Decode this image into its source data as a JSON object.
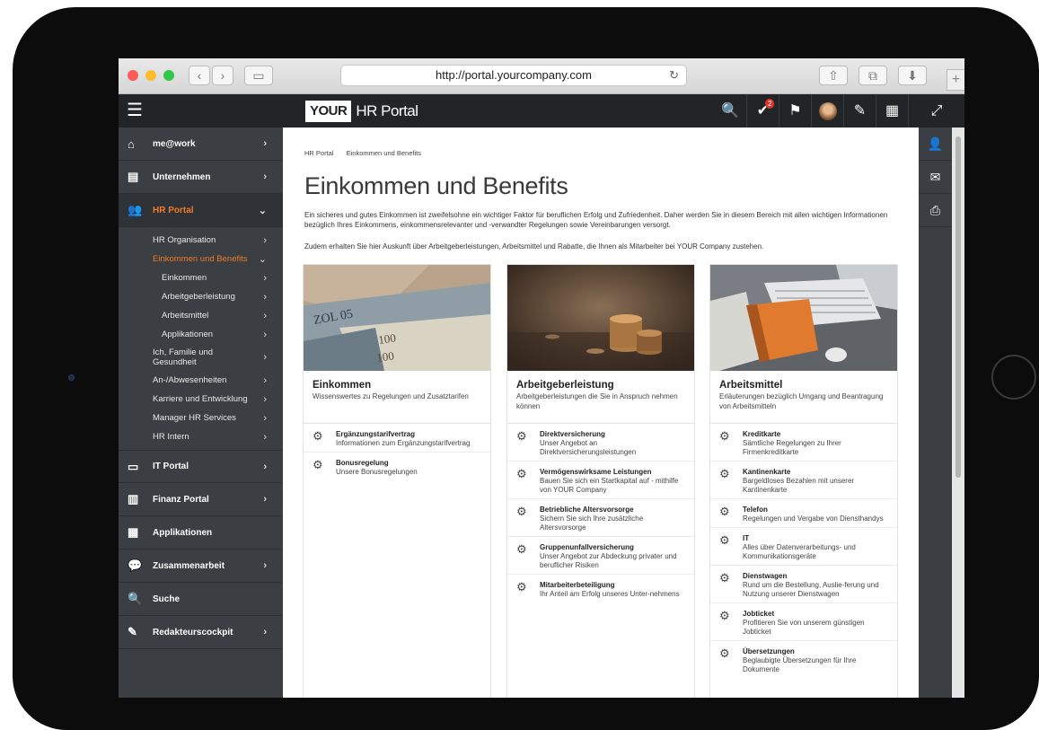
{
  "browser": {
    "url": "http://portal.yourcompany.com",
    "back_glyph": "‹",
    "forward_glyph": "›",
    "sidebar_glyph": "▭",
    "reload_glyph": "↻",
    "share_glyph": "⇧",
    "tabs_glyph": "⧉",
    "download_glyph": "⬇",
    "new_tab_glyph": "+"
  },
  "app": {
    "logo_your": "YOUR",
    "logo_rest": "HR Portal",
    "menu_glyph": "☰",
    "notification_count": "2",
    "icons": {
      "search": "🔍",
      "tasks": "✔",
      "flag": "⚑",
      "edit": "✎",
      "apps": "▦",
      "expand": "⤢"
    }
  },
  "sidebar": {
    "chevron_right": "›",
    "chevron_down": "⌄",
    "items": [
      {
        "label": "me@work",
        "icon": "⌂"
      },
      {
        "label": "Unternehmen",
        "icon": "▤"
      },
      {
        "label": "HR Portal",
        "icon": "👥"
      },
      {
        "label": "IT Portal",
        "icon": "▭"
      },
      {
        "label": "Finanz Portal",
        "icon": "▥"
      },
      {
        "label": "Applikationen",
        "icon": "▦"
      },
      {
        "label": "Zusammenarbeit",
        "icon": "💬"
      },
      {
        "label": "Suche",
        "icon": "🔍"
      },
      {
        "label": "Redakteurscockpit",
        "icon": "✎"
      }
    ],
    "hr_sub": [
      "HR Organisation",
      "Einkommen und Benefits",
      "Einkommen",
      "Arbeitgeberleistung",
      "Arbeitsmittel",
      "Applikationen",
      "Ich, Familie und Gesundheit",
      "An-/Abwesenheiten",
      "Karriere und Entwicklung",
      "Manager HR Services",
      "HR Intern"
    ]
  },
  "rightbar": {
    "user_glyph": "👤",
    "mail_glyph": "✉",
    "print_glyph": "⎙"
  },
  "content": {
    "breadcrumb": [
      "HR Portal",
      "Einkommen und Benefits"
    ],
    "title": "Einkommen und Benefits",
    "intro1": "Ein sicheres und gutes Einkommen ist zweifelsohne ein wichtiger Faktor für beruflichen Erfolg und Zufriedenheit. Daher werden Sie in diesem Bereich mit allen wichtigen Informationen bezüglich Ihres Einkommens, einkommensrelevanter und -verwandter Regelungen sowie Vereinbarungen versorgt.",
    "intro2": "Zudem erhalten Sie hier Auskunft über Arbeitgeberleistungen, Arbeitsmittel und Rabatte, die Ihnen als Mitarbeiter bei YOUR Company zustehen.",
    "gear_glyph": "⚙",
    "cards": [
      {
        "title": "Einkommen",
        "desc": "Wissenswertes zu Regelungen und Zusatztarifen",
        "items": [
          {
            "title": "Ergänzungstarifvertrag",
            "desc": "Informationen zum Ergänzungstarifvertrag"
          },
          {
            "title": "Bonusregelung",
            "desc": "Unsere Bonusregelungen"
          }
        ]
      },
      {
        "title": "Arbeitgeberleistung",
        "desc": "Arbeitgeberleistungen die Sie in Anspruch nehmen können",
        "items": [
          {
            "title": "Direktversicherung",
            "desc": "Unser Angebot an Direktversicherungsleistungen"
          },
          {
            "title": "Vermögenswirksame Leistungen",
            "desc": "Bauen Sie sich ein Startkapital auf - mithilfe von YOUR Company"
          },
          {
            "title": "Betriebliche Altersvorsorge",
            "desc": "Sichern Sie sich Ihre zusätzliche Altersvorsorge"
          },
          {
            "title": "Gruppenunfallversicherung",
            "desc": "Unser Angebot zur Abdeckung privater und beruflicher Risiken"
          },
          {
            "title": "Mitarbeiterbeteiligung",
            "desc": "Ihr Anteil am Erfolg unseres Unter-nehmens"
          }
        ]
      },
      {
        "title": "Arbeitsmittel",
        "desc": "Erläuterungen bezüglich Umgang und Beantragung von Arbeitsmitteln",
        "items": [
          {
            "title": "Kreditkarte",
            "desc": "Sämtliche Regelungen zu Ihrer Firmenkreditkarte"
          },
          {
            "title": "Kantinenkarte",
            "desc": "Bargeldloses Bezahlen mit unserer Kantinenkarte"
          },
          {
            "title": "Telefon",
            "desc": "Regelungen und Vergabe von Diensthandys"
          },
          {
            "title": "IT",
            "desc": "Alles über Datenverarbeitungs- und Kommunikationsgeräte"
          },
          {
            "title": "Dienstwagen",
            "desc": "Rund um die Bestellung, Auslie-ferung und Nutzung unserer Dienstwagen"
          },
          {
            "title": "Jobticket",
            "desc": "Profitieren Sie von unserem günstigen Jobticket"
          },
          {
            "title": "Übersetzungen",
            "desc": "Beglaubigte Übersetzungen für Ihre Dokumente"
          }
        ]
      }
    ]
  }
}
